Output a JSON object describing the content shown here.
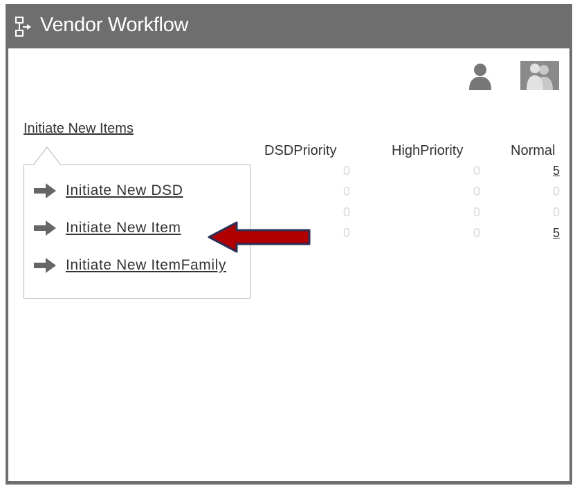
{
  "window": {
    "title": "Vendor Workflow",
    "app_icon": "workflow-icon",
    "colors": {
      "titlebar": "#6e6e6e",
      "accent_arrow": "#b00000"
    }
  },
  "toolbar": {
    "user_icon": "user-icon",
    "group_icon": "group-icon"
  },
  "initiate": {
    "link_label": "Initiate New Items",
    "menu": [
      {
        "label": "Initiate  New  DSD",
        "icon": "arrow-right-icon"
      },
      {
        "label": "Initiate  New  Item",
        "icon": "arrow-right-icon"
      },
      {
        "label": "Initiate  New  ItemFamily",
        "icon": "arrow-right-icon"
      }
    ]
  },
  "grid": {
    "columns": [
      "DSDPriority",
      "HighPriority",
      "Normal"
    ],
    "rows": [
      [
        "0",
        "0",
        "5"
      ],
      [
        "0",
        "0",
        "0"
      ],
      [
        "0",
        "0",
        "0"
      ],
      [
        "0",
        "0",
        "5"
      ]
    ]
  }
}
